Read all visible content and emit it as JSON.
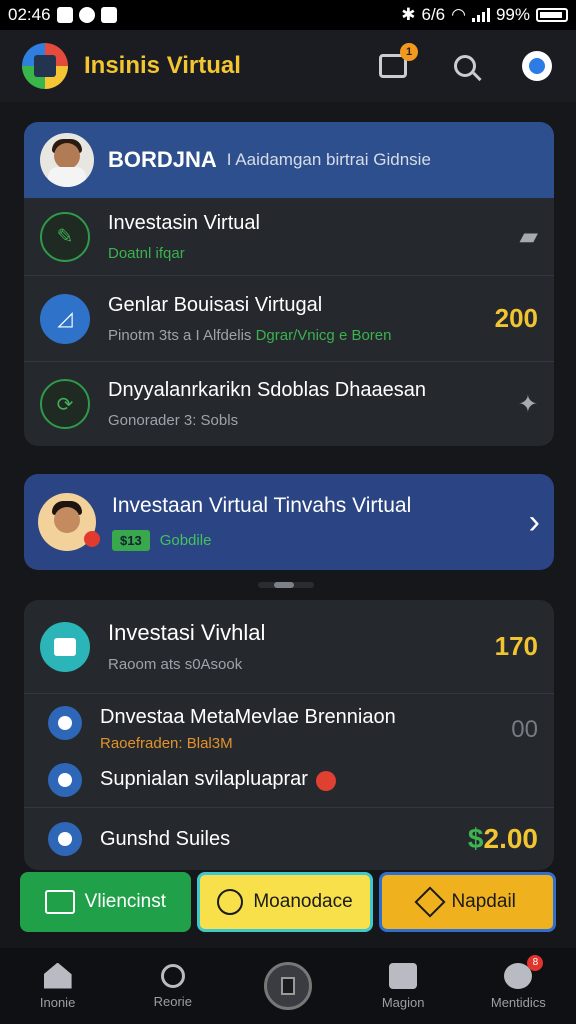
{
  "status_bar": {
    "time": "02:46",
    "network": "6/6",
    "battery": "99%"
  },
  "header": {
    "title": "Insinis Virtual"
  },
  "notifications": {
    "badge": "1"
  },
  "card1": {
    "title": "BORDJNA",
    "subtitle": "I Aaidamgan birtrai Gidnsie",
    "rows": [
      {
        "title": "Investasin Virtual",
        "sub": "Doatnl ifqar",
        "right": ""
      },
      {
        "title": "Genlar Bouisasi Virtugal",
        "sub": "Pinotm 3ts a I Alfdelis",
        "sub_green": "Dgrar/Vnicg e Boren",
        "right": "200"
      },
      {
        "title": "Dnyyalanrkarikn Sdoblas Dhaaesan",
        "sub": "Gonorader 3: Sobls",
        "right": ""
      }
    ]
  },
  "card2": {
    "title": "Investaan Virtual Tinvahs Virtual",
    "tag": "$13",
    "tag_text": "Gobdile"
  },
  "card3": {
    "rows": [
      {
        "title": "Investasi Vivhlal",
        "sub": "Raoom ats s0Asook",
        "right": "170"
      },
      {
        "title": "Dnvestaa MetaMevlae Brenniaon",
        "sub": "Raoefraden: Blal3M",
        "right": "00"
      },
      {
        "title": "Supnialan svilapluaprar",
        "sub": "",
        "right": ""
      },
      {
        "title": "Gunshd Suiles",
        "sub": "",
        "right": "2.00",
        "currency": "$"
      }
    ]
  },
  "action_buttons": {
    "green": "Vliencinst",
    "yellow": "Moanodace",
    "orange": "Napdail"
  },
  "bottom_nav": {
    "items": [
      "Inonie",
      "Reorie",
      "",
      "Magion",
      "Mentidics"
    ],
    "badge": "8"
  },
  "colors": {
    "accent": "#f2c531",
    "header_blue": "#2d4f8d",
    "green": "#21a04a"
  }
}
